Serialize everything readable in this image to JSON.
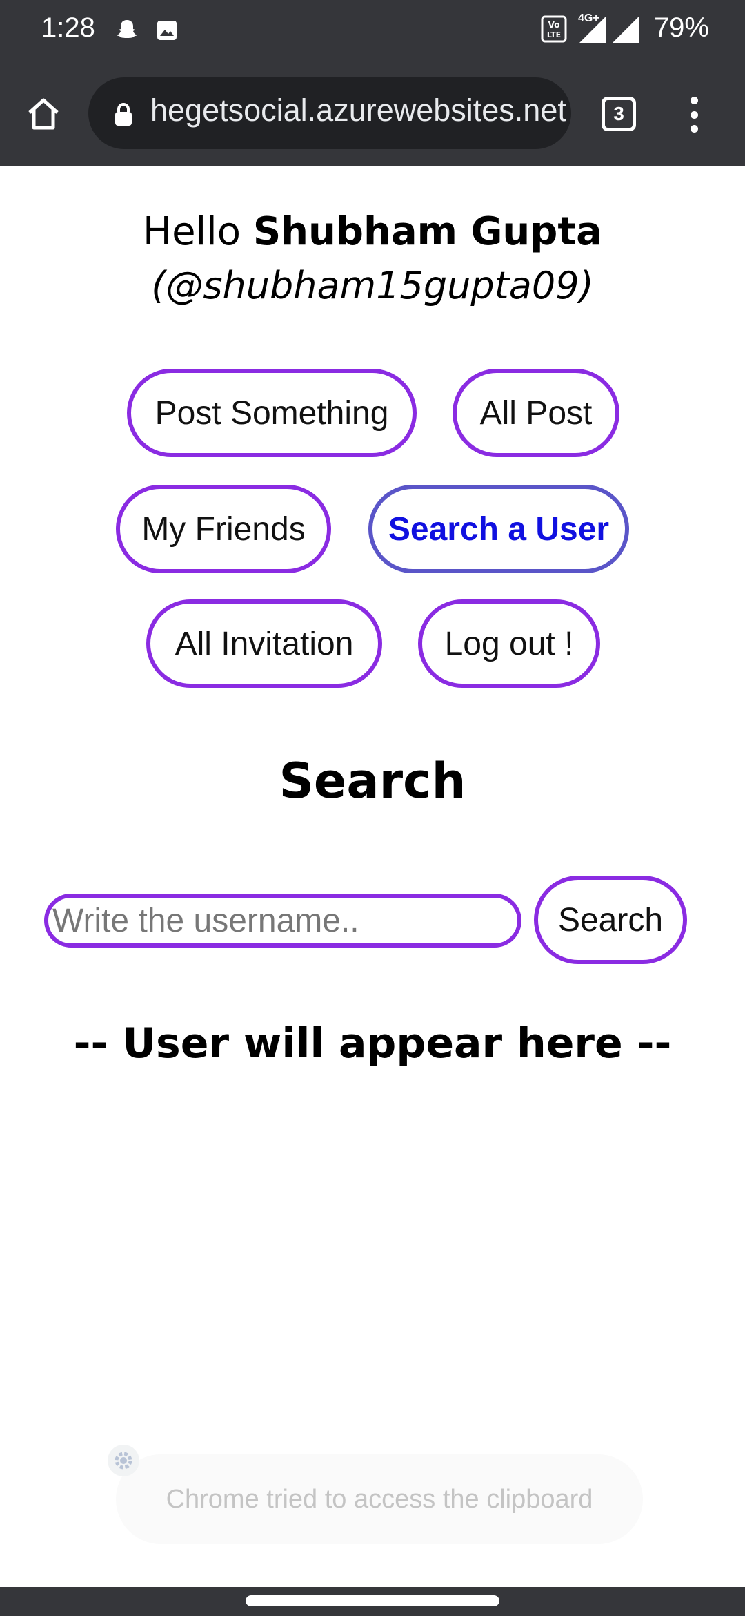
{
  "status_bar": {
    "time": "1:28",
    "battery": "79%",
    "network": "4G+",
    "icons": [
      "snapchat-icon",
      "image-icon",
      "volte-icon",
      "signal-icon",
      "signal-icon",
      "battery-icon"
    ]
  },
  "browser": {
    "url": "hegetsocial.azurewebsites.net",
    "tab_count": "3"
  },
  "header": {
    "greeting_prefix": "Hello",
    "user_name": "Shubham Gupta",
    "user_handle": "(@shubham15gupta09)"
  },
  "nav_buttons": [
    {
      "label": "Post Something",
      "active": false
    },
    {
      "label": "All Post",
      "active": false
    },
    {
      "label": "My Friends",
      "active": false
    },
    {
      "label": "Search a User",
      "active": true
    },
    {
      "label": "All Invitation",
      "active": false
    },
    {
      "label": "Log out !",
      "active": false
    }
  ],
  "search": {
    "heading": "Search",
    "placeholder": "Write the username..",
    "value": "",
    "button_label": "Search"
  },
  "result": {
    "text": "-- User will appear here --"
  },
  "toast": {
    "text": "Chrome tried to access the clipboard"
  },
  "colors": {
    "accent": "#8a2be2",
    "active_text": "#1010e0",
    "chrome_bg": "#35363a"
  }
}
